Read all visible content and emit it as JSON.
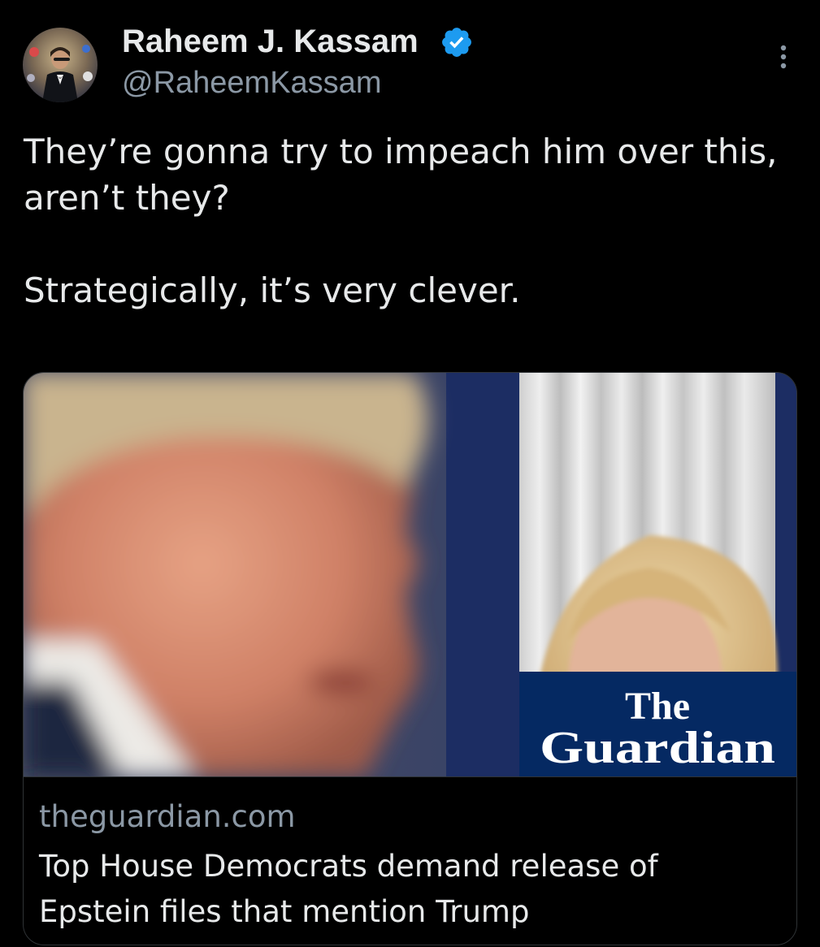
{
  "tweet": {
    "display_name": "Raheem J. Kassam",
    "handle": "@RaheemKassam",
    "verified": true,
    "verified_color": "#1d9bf0",
    "text_lines": [
      "They’re gonna try to impeach him over this, aren’t they?",
      "Strategically, it’s very clever."
    ],
    "icons": {
      "avatar": "avatar-image",
      "verified": "verified-badge-icon",
      "more": "more-options-icon"
    }
  },
  "link_card": {
    "domain": "theguardian.com",
    "title": "Top House Democrats demand release of Epstein files that mention Trump",
    "logo_text": "The Guardian",
    "logo_color": "#052962"
  }
}
